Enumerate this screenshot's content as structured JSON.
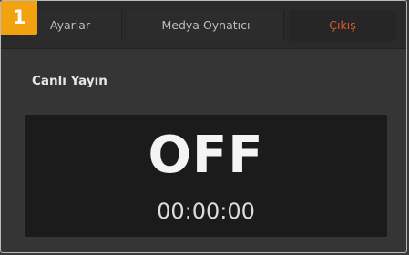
{
  "step_number": "1",
  "tabs": [
    {
      "label": "Ayarlar",
      "active": false
    },
    {
      "label": "Medya Oynatıcı",
      "active": false
    },
    {
      "label": "Çıkış",
      "active": true
    }
  ],
  "section": {
    "title": "Canlı Yayın"
  },
  "live_display": {
    "status": "OFF",
    "timer": "00:00:00"
  },
  "colors": {
    "badge": "#f2a20e",
    "active_tab_text": "#e05a2a",
    "panel_bg": "#353535",
    "display_bg": "#1b1b1b"
  }
}
